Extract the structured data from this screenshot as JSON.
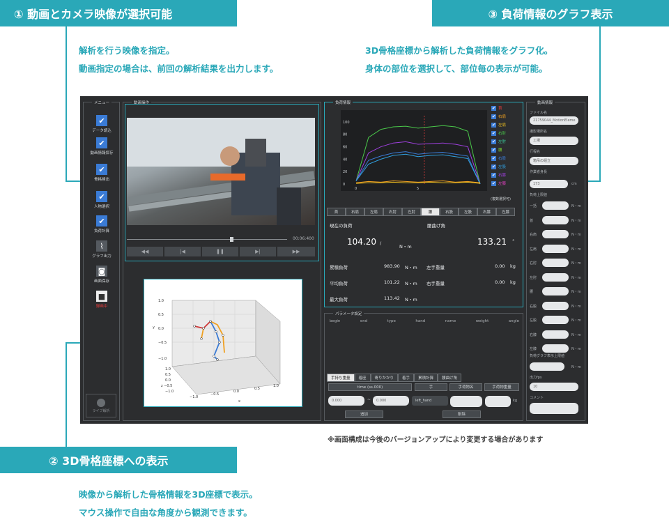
{
  "callouts": {
    "c1": {
      "title": "① 動画とカメラ映像が選択可能",
      "line1": "解析を行う映像を指定。",
      "line2": "動画指定の場合は、前回の解析結果を出力します。"
    },
    "c2": {
      "title": "② 3D骨格座標への表示",
      "line1": "映像から解析した骨格情報を3D座標で表示。",
      "line2": "マウス操作で自由な角度から観測できます。"
    },
    "c3": {
      "title": "③ 負荷情報のグラフ表示",
      "line1": "3D骨格座標から解析した負荷情報をグラフ化。",
      "line2": "身体の部位を選択して、部位毎の表示が可能。"
    }
  },
  "note": "※画面構成は今後のバージョンアップにより変更する場合があります",
  "colors": {
    "accent": "#2aa8b8",
    "app_bg": "#2c2d2f",
    "check": "#3a7bd5"
  },
  "menu": {
    "title": "メニュー",
    "items": [
      {
        "label": "データ読込",
        "checked": true
      },
      {
        "label": "動画情報保存",
        "checked": true
      },
      {
        "label": "骨格検出",
        "checked": true
      },
      {
        "label": "人物選択",
        "checked": true
      },
      {
        "label": "負荷計算",
        "checked": true
      },
      {
        "label": "グラフ出力",
        "checked": false
      },
      {
        "label": "画面保存",
        "checked": false
      }
    ],
    "record_label": "録画中",
    "live_label": "ライブ解析"
  },
  "video_panel": {
    "title": "動画操作",
    "time": "00:06:400",
    "controls": [
      "rewind-icon",
      "prev-icon",
      "pause-icon",
      "next-icon",
      "forward-icon"
    ]
  },
  "load_panel": {
    "title": "負荷情報",
    "legend": [
      "首",
      "右肩",
      "左肩",
      "右肘",
      "左肘",
      "腰",
      "右股",
      "左股",
      "右膝",
      "左膝"
    ],
    "legend_note": "(複数選択可)",
    "y_ticks": [
      "100",
      "80",
      "60",
      "40",
      "20",
      "0"
    ],
    "x_ticks": [
      "0",
      "5"
    ],
    "tabs": [
      "首",
      "右肩",
      "左肩",
      "右肘",
      "左肘",
      "腰",
      "右股",
      "左股",
      "右膝",
      "左膝"
    ],
    "current_load_label": "現在の負荷",
    "current_load_value": "104.20",
    "slash": "/",
    "unit_nm": "N・m",
    "waist_angle_label": "腰曲げ角",
    "waist_angle_value": "133.21",
    "degree": "°",
    "stats": [
      {
        "label": "累積負荷",
        "value": "983.90",
        "unit": "N・m"
      },
      {
        "label": "平均負荷",
        "value": "101.22",
        "unit": "N・m"
      },
      {
        "label": "最大負荷",
        "value": "113.42",
        "unit": "N・m"
      }
    ],
    "hand_weights": [
      {
        "label": "左手重量",
        "value": "0.00",
        "unit": "kg"
      },
      {
        "label": "右手重量",
        "value": "0.00",
        "unit": "kg"
      }
    ]
  },
  "param_panel": {
    "title": "パラメータ設定",
    "columns": [
      "begin",
      "end",
      "type",
      "hand",
      "name",
      "weight",
      "angle"
    ],
    "tabs": [
      "手持ち重量",
      "着座",
      "寄りかかり",
      "着手",
      "累積計算",
      "腰曲げ角"
    ],
    "headers": [
      "time (ss.000)",
      "手",
      "手荷物名",
      "手荷物重量"
    ],
    "begin": "0.000",
    "end": "0.000",
    "tilde": "~",
    "hand": "left_hand",
    "unit_kg": "kg",
    "add": "追加",
    "delete": "削除"
  },
  "video_info": {
    "title": "動画情報",
    "file_label": "ファイル名",
    "file_value": "21759044_MotionEleme",
    "place_label": "撮影場所名",
    "place_value": "工場",
    "work_label": "行程名",
    "work_value": "箱吊の組立",
    "height_label": "作業者身長",
    "height_value": "173",
    "height_unit": "cm",
    "limit_label": "負荷上限値",
    "limit_rows": [
      "一括",
      "首",
      "右肩",
      "左肩",
      "右肘",
      "左肘",
      "腰",
      "右股",
      "左股",
      "右膝",
      "左膝"
    ],
    "limit_unit": "N・m",
    "graph_limit_label": "負荷グラフ表示上限値",
    "fps_label": "出力fps",
    "fps_value": "10",
    "comment_label": "コメント"
  },
  "chart_data": {
    "type": "line",
    "x": [
      0,
      1,
      2,
      3,
      4,
      5,
      6,
      7,
      8,
      9,
      10
    ],
    "ylim": [
      0,
      110
    ],
    "series": [
      {
        "name": "首",
        "values": [
          5,
          75,
          88,
          92,
          93,
          90,
          92,
          94,
          92,
          85,
          0
        ]
      },
      {
        "name": "腰",
        "values": [
          5,
          50,
          60,
          66,
          68,
          64,
          65,
          66,
          64,
          60,
          0
        ]
      },
      {
        "name": "右股",
        "values": [
          5,
          38,
          45,
          50,
          52,
          48,
          50,
          51,
          48,
          45,
          0
        ]
      },
      {
        "name": "左股",
        "values": [
          5,
          32,
          40,
          46,
          48,
          44,
          46,
          47,
          44,
          41,
          0
        ]
      },
      {
        "name": "右膝",
        "values": [
          2,
          4,
          3,
          5,
          4,
          3,
          4,
          5,
          3,
          4,
          2
        ]
      },
      {
        "name": "左膝",
        "values": [
          1,
          2,
          2,
          3,
          2,
          2,
          3,
          2,
          2,
          3,
          1
        ]
      }
    ]
  }
}
